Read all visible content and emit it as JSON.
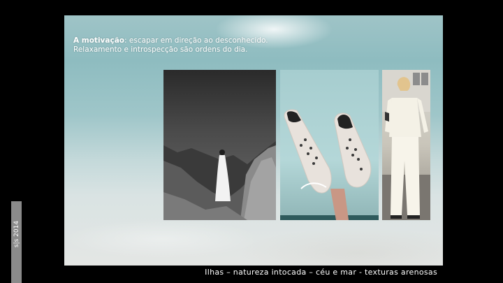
{
  "caption": {
    "lead_bold": "A motivação",
    "lead_rest": ": escapar em direção ao desconhecido.",
    "line2": "Relaxamento e introspecção são ordens do dia."
  },
  "side_tab": {
    "label": "s|s 2014"
  },
  "footer": {
    "text": "Ilhas – natureza intocada – céu e mar -  texturas arenosas"
  },
  "photos": [
    {
      "subject": "woman-in-white-dress-rocks",
      "style": "black-and-white"
    },
    {
      "subject": "sneakers-in-air",
      "style": "color"
    },
    {
      "subject": "woman-in-white-outfit",
      "style": "color"
    }
  ],
  "colors": {
    "background": "#000000",
    "sea_top": "#9fc4c7",
    "sand": "#e4e6e4",
    "tab": "#8a8a8a",
    "text": "#ffffff"
  }
}
